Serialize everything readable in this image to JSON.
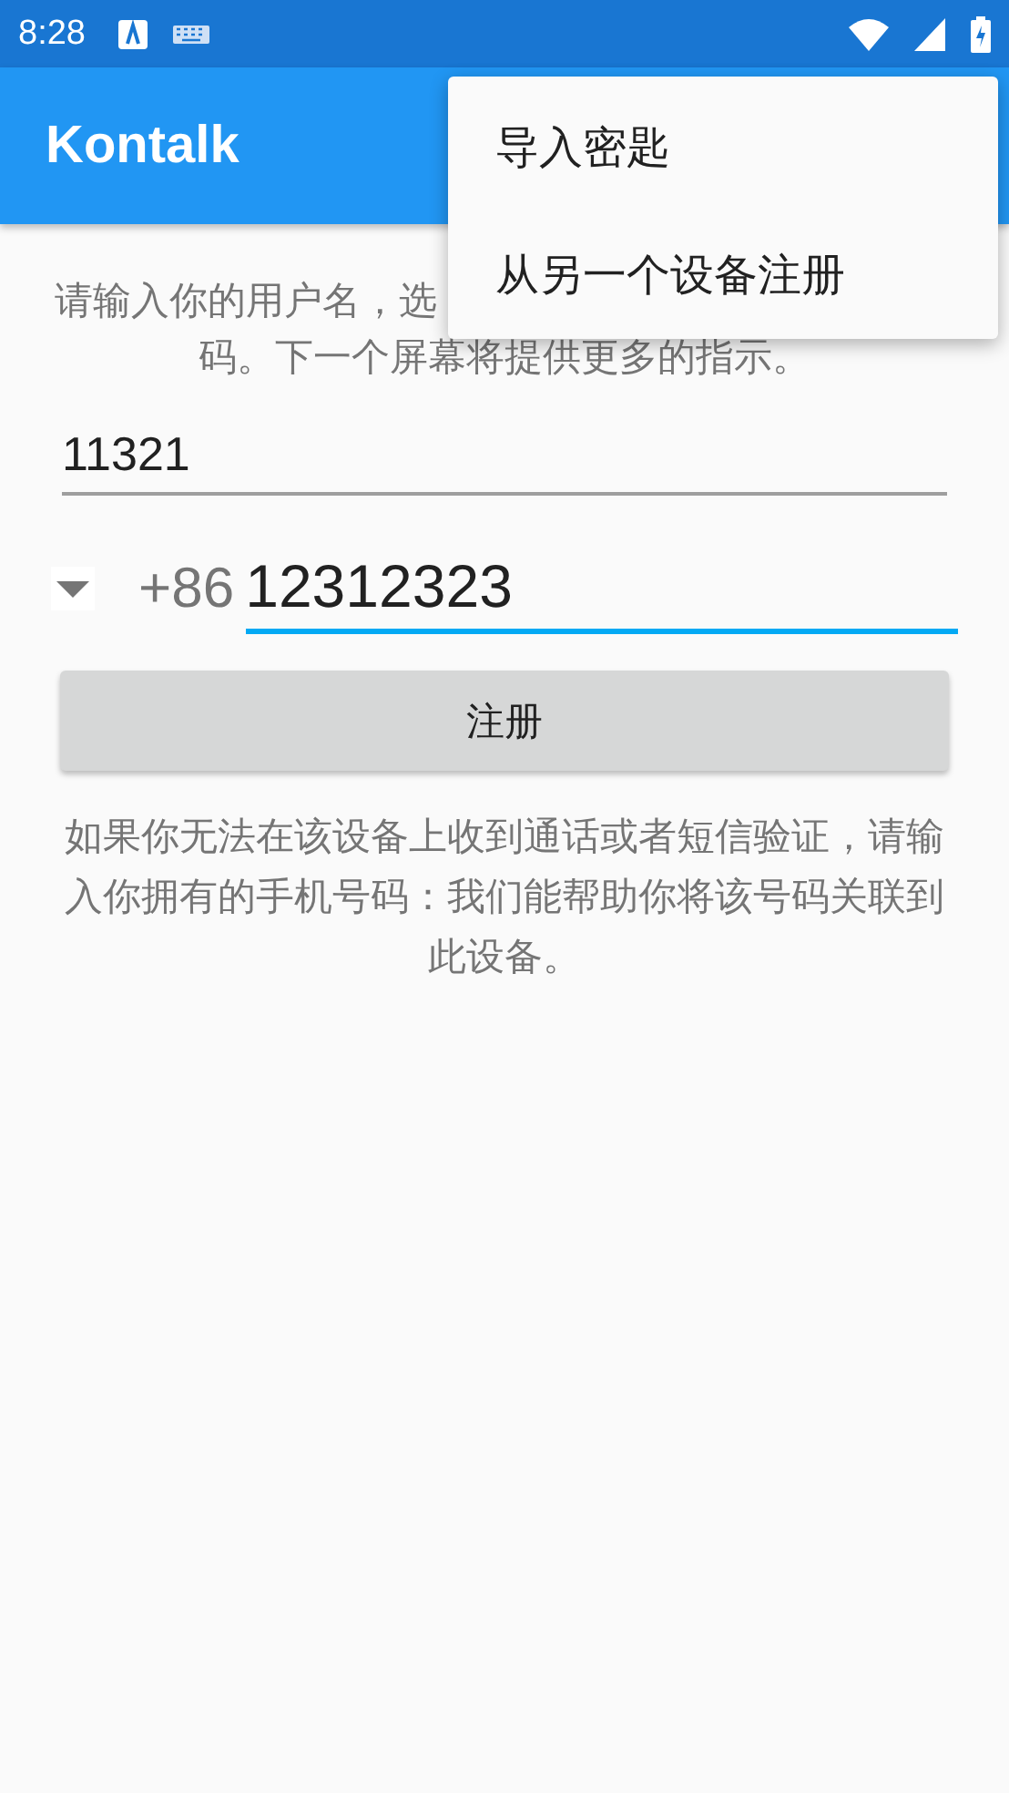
{
  "status_bar": {
    "time": "8:28"
  },
  "app_bar": {
    "title": "Kontalk"
  },
  "menu": {
    "items": [
      {
        "label": "导入密匙"
      },
      {
        "label": "从另一个设备注册"
      }
    ]
  },
  "intro": {
    "line_1": "请输入你的用户名，选",
    "line_2": "码。下一个屏幕将提供更多的指示。"
  },
  "username_field": {
    "value": "11321",
    "focused": false
  },
  "phone": {
    "country_code": "+86",
    "value": "12312323",
    "focused": true
  },
  "register_button": {
    "label": "注册"
  },
  "help_text": "如果你无法在该设备上收到通话或者短信验证，请输入你拥有的手机号码：我们能帮助你将该号码关联到此设备。"
}
